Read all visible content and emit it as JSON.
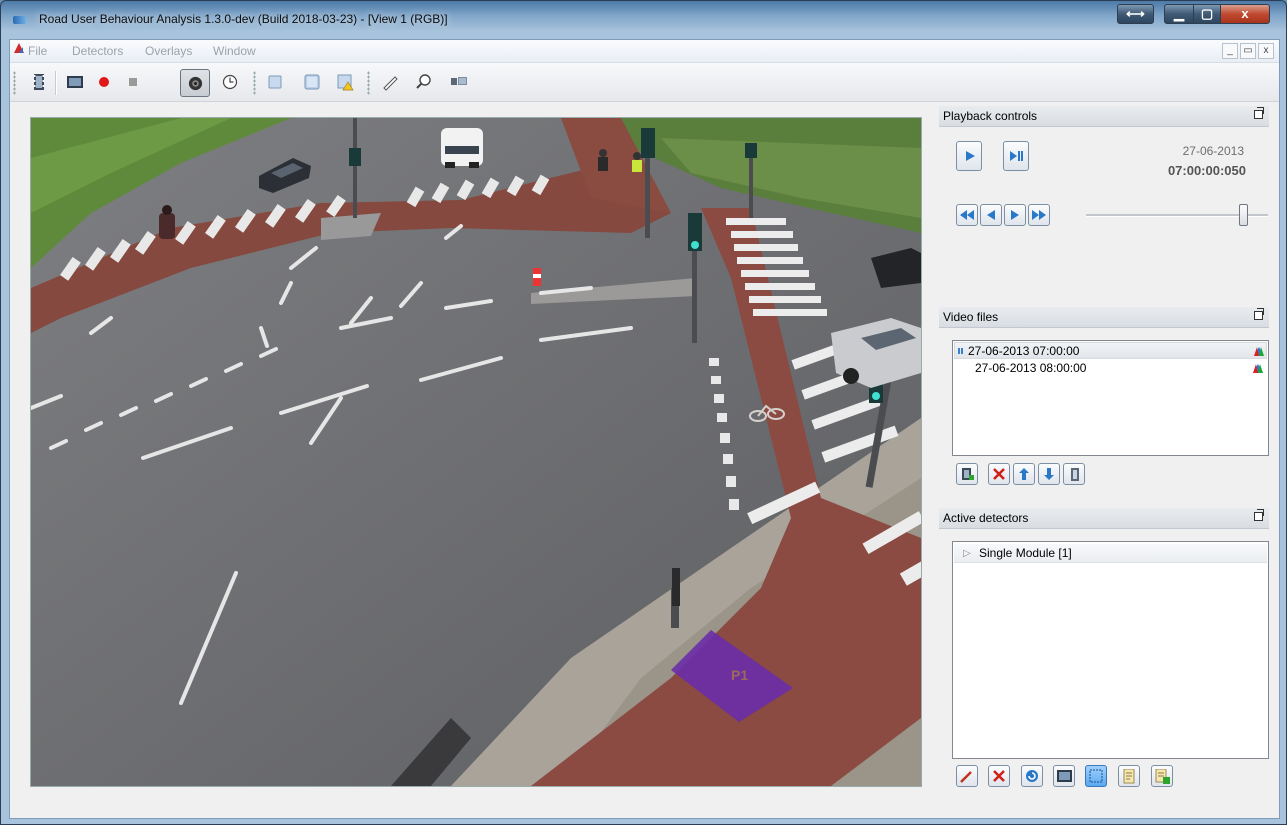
{
  "window": {
    "title": "Road User Behaviour Analysis 1.3.0-dev (Build 2018-03-23) - [View 1 (RGB)]",
    "controls": {
      "resize": "⟷",
      "minimize": "▁",
      "maximize": "▢",
      "close": "x"
    }
  },
  "menubar": {
    "items": [
      "File",
      "Detectors",
      "Overlays",
      "Window"
    ],
    "mdi_controls": {
      "minimize": "_",
      "restore": "▭",
      "close": "x"
    }
  },
  "toolbar": {
    "icons": [
      "film-icon",
      "image-icon",
      "record-icon",
      "stop-icon",
      "camera-icon",
      "clock-icon",
      "square-icon",
      "layers-icon",
      "warning-image-icon",
      "measure-icon",
      "zoom-icon",
      "display-icon"
    ]
  },
  "video": {
    "zone_label": "P1",
    "colors": {
      "asphalt": "#6e6f72",
      "bike_lane": "#8b4a42",
      "grass": "#5f8a3c",
      "zone": "#6a2ea8"
    }
  },
  "playback": {
    "title": "Playback controls",
    "date": "27-06-2013",
    "time": "07:00:00:050",
    "slider_fraction": 0.86
  },
  "video_files": {
    "title": "Video files",
    "files": [
      {
        "label": "27-06-2013 07:00:00",
        "playing": true
      },
      {
        "label": "27-06-2013 08:00:00",
        "playing": false
      }
    ]
  },
  "detectors": {
    "title": "Active detectors",
    "items": [
      {
        "label": "Single Module [1]"
      }
    ]
  }
}
